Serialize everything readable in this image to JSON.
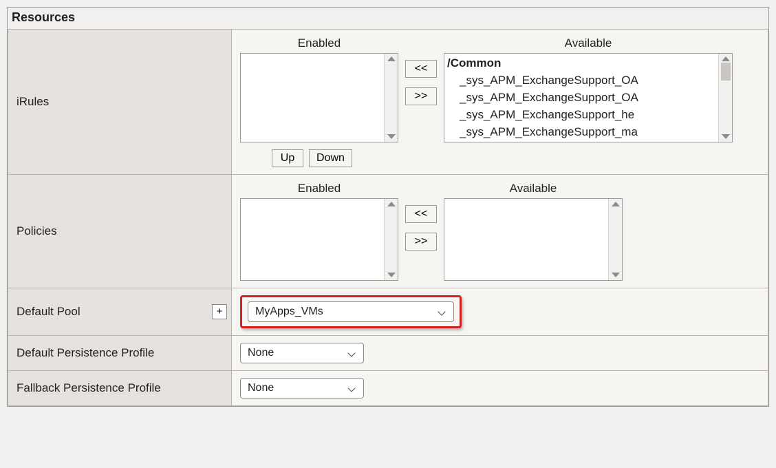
{
  "panel": {
    "title": "Resources"
  },
  "rows": {
    "irules": {
      "label": "iRules",
      "enabled_header": "Enabled",
      "available_header": "Available",
      "move_left": "<<",
      "move_right": ">>",
      "up": "Up",
      "down": "Down",
      "available_group": "/Common",
      "available_items": [
        "_sys_APM_ExchangeSupport_OA",
        "_sys_APM_ExchangeSupport_OA",
        "_sys_APM_ExchangeSupport_he",
        "_sys_APM_ExchangeSupport_ma"
      ]
    },
    "policies": {
      "label": "Policies",
      "enabled_header": "Enabled",
      "available_header": "Available",
      "move_left": "<<",
      "move_right": ">>"
    },
    "default_pool": {
      "label": "Default Pool",
      "plus": "+",
      "value": "MyApps_VMs"
    },
    "default_persistence": {
      "label": "Default Persistence Profile",
      "value": "None"
    },
    "fallback_persistence": {
      "label": "Fallback Persistence Profile",
      "value": "None"
    }
  }
}
